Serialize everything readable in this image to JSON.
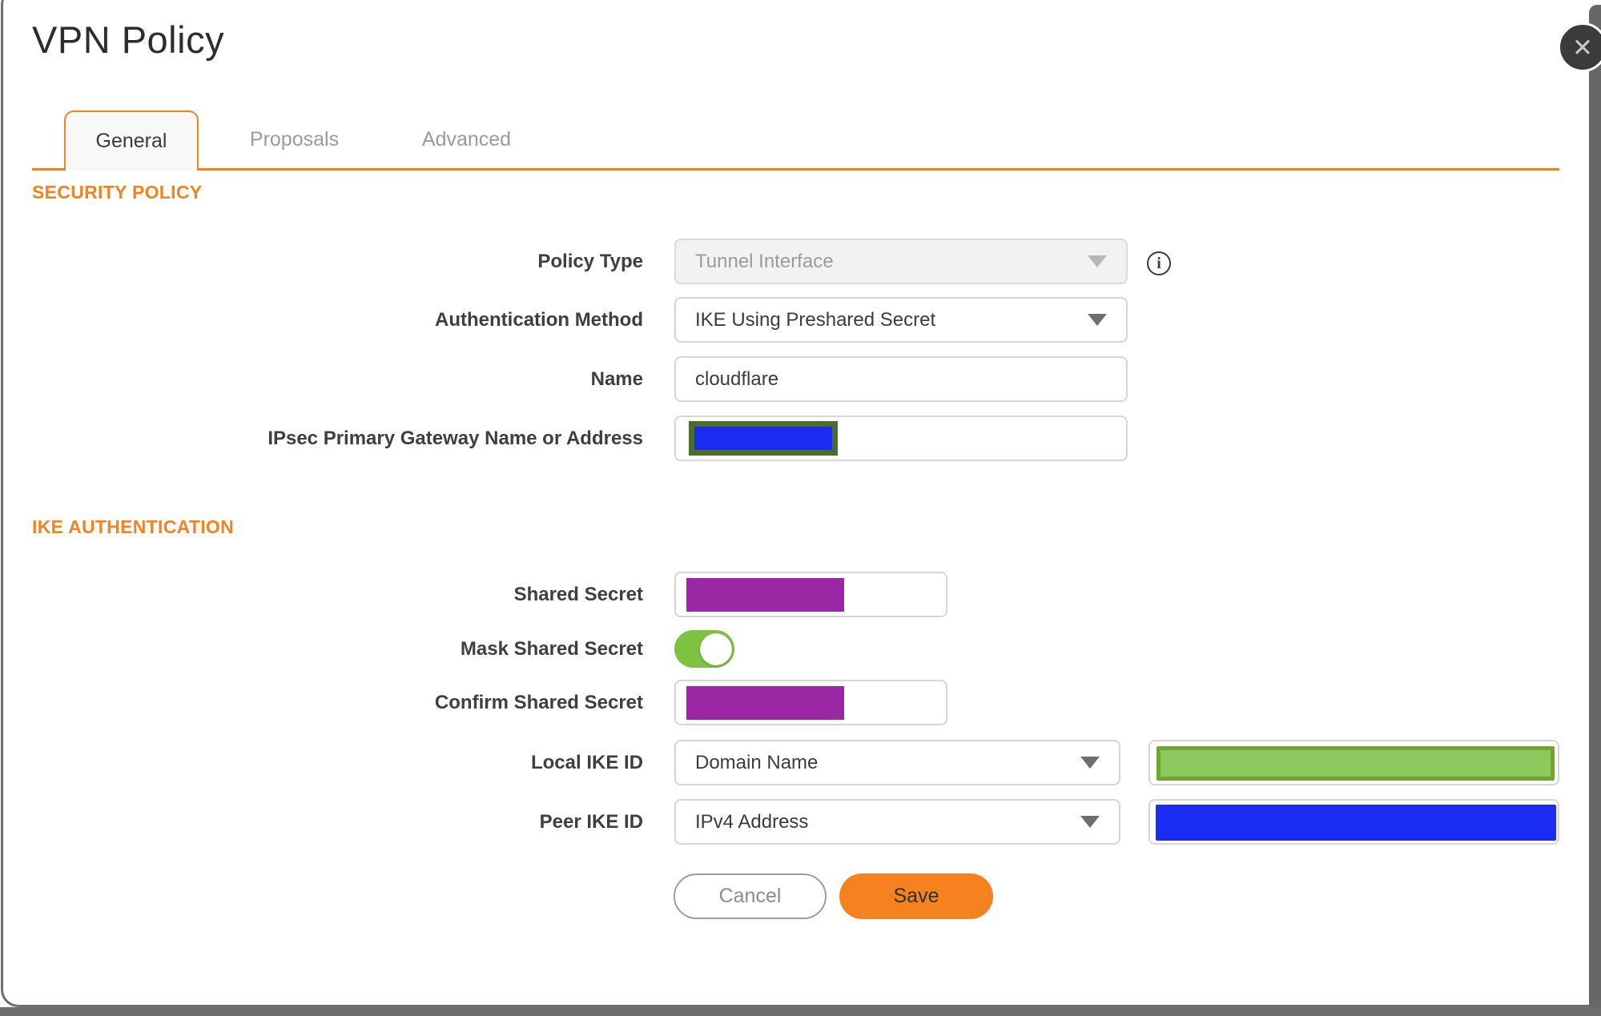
{
  "dialog": {
    "title": "VPN Policy"
  },
  "icons": {
    "close": "✕",
    "info": "i"
  },
  "tabs": [
    {
      "label": "General",
      "active": true
    },
    {
      "label": "Proposals",
      "active": false
    },
    {
      "label": "Advanced",
      "active": false
    }
  ],
  "security_policy": {
    "heading": "SECURITY POLICY",
    "policy_type": {
      "label": "Policy Type",
      "value": "Tunnel Interface",
      "disabled": true
    },
    "authentication_method": {
      "label": "Authentication Method",
      "value": "IKE Using Preshared Secret"
    },
    "name": {
      "label": "Name",
      "value": "cloudflare"
    },
    "gateway": {
      "label": "IPsec Primary Gateway Name or Address",
      "value_redacted": true
    }
  },
  "ike_authentication": {
    "heading": "IKE AUTHENTICATION",
    "shared_secret": {
      "label": "Shared Secret",
      "value_redacted": true
    },
    "mask_shared_secret": {
      "label": "Mask Shared Secret",
      "state": "on"
    },
    "confirm_shared_secret": {
      "label": "Confirm Shared Secret",
      "value_redacted": true
    },
    "local_ike_id": {
      "label": "Local IKE ID",
      "type_value": "Domain Name",
      "id_value_redacted": true
    },
    "peer_ike_id": {
      "label": "Peer IKE ID",
      "type_value": "IPv4 Address",
      "id_value_redacted": true
    }
  },
  "actions": {
    "cancel": "Cancel",
    "save": "Save"
  },
  "colors": {
    "accent_orange": "#F58220",
    "redaction_purple": "#9C27A4",
    "redaction_blue": "#1B2CF2",
    "redaction_green_fill": "#8CC95E",
    "redaction_green_border": "#73A433",
    "redaction_olive_border": "#4D6E2B",
    "toggle_green": "#7FC241",
    "backdrop_gray": "#6B6B6B"
  }
}
